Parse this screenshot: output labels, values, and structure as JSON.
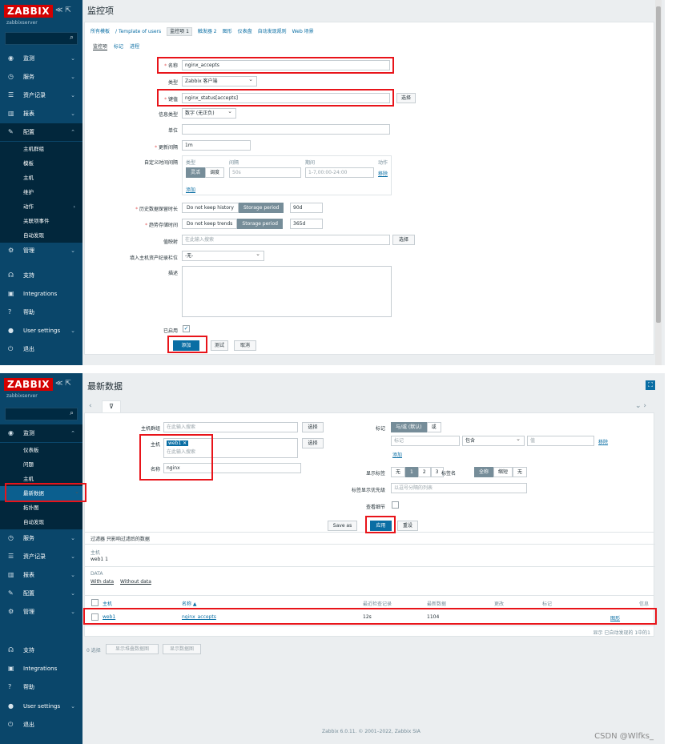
{
  "sidebar": {
    "logo": "ZABBIX",
    "collapse_icons": "≪ ⇱",
    "server": "zabbixserver",
    "search_icon": "search-icon"
  },
  "panel1": {
    "page_title": "监控项",
    "breadcrumb": [
      "所有模板",
      "Template of users",
      "监控项 1",
      "触发器 2",
      "图形",
      "仪表盘",
      "自动发现规则",
      "Web 场景"
    ],
    "tabs": [
      "监控项",
      "标记",
      "进程"
    ],
    "menu": [
      {
        "label": "监测",
        "icon": "eye-icon"
      },
      {
        "label": "服务",
        "icon": "clock-icon"
      },
      {
        "label": "资产记录",
        "icon": "list-icon"
      },
      {
        "label": "报表",
        "icon": "chart-icon"
      },
      {
        "label": "配置",
        "icon": "wrench-icon"
      }
    ],
    "submenu": [
      "主机群组",
      "模板",
      "主机",
      "维护",
      "动作",
      "关联项事件",
      "自动发现"
    ],
    "menu_bottom": [
      {
        "label": "管理",
        "icon": "gear-icon"
      },
      {
        "label": "支持",
        "icon": "headset-icon"
      },
      {
        "label": "Integrations",
        "icon": "z-icon"
      },
      {
        "label": "帮助",
        "icon": "question-icon"
      },
      {
        "label": "User settings",
        "icon": "user-icon"
      },
      {
        "label": "退出",
        "icon": "power-icon"
      }
    ],
    "form": {
      "name_label": "名称",
      "name_value": "nginx_accepts",
      "type_label": "类型",
      "type_value": "Zabbix 客户端",
      "key_label": "键值",
      "key_value": "nginx_status[accepts]",
      "key_select": "选择",
      "info_type_label": "信息类型",
      "info_type_value": "数字 (无正负)",
      "units_label": "单位",
      "interval_label": "更新间隔",
      "interval_value": "1m",
      "custom_label": "自定义时间间隔",
      "custom_headers": [
        "类型",
        "间隔",
        "期间",
        "动作"
      ],
      "custom_type_flex": "灵活",
      "custom_type_sched": "调度",
      "custom_interval": "50s",
      "custom_period": "1-7,00:00-24:00",
      "custom_remove": "移除",
      "custom_add": "添加",
      "history_label": "历史数据保留时长",
      "history_opt1": "Do not keep history",
      "history_opt2": "Storage period",
      "history_value": "90d",
      "trends_label": "趋势存储时间",
      "trends_opt1": "Do not keep trends",
      "trends_opt2": "Storage period",
      "trends_value": "365d",
      "valuemap_label": "值映射",
      "valuemap_placeholder": "在此输入搜索",
      "valuemap_select": "选择",
      "inventory_label": "填入主机资产纪录栏位",
      "inventory_value": "-无-",
      "desc_label": "描述",
      "enabled_label": "已启用",
      "add_button": "添加",
      "test_button": "测试",
      "cancel_button": "取消"
    }
  },
  "panel2": {
    "page_title": "最新数据",
    "menu_top": [
      {
        "label": "监测",
        "icon": "eye-icon"
      }
    ],
    "submenu": [
      "仪表板",
      "问题",
      "主机",
      "最新数据",
      "拓扑图",
      "自动发现"
    ],
    "menu_mid": [
      {
        "label": "服务",
        "icon": "clock-icon"
      },
      {
        "label": "资产记录",
        "icon": "list-icon"
      },
      {
        "label": "报表",
        "icon": "chart-icon"
      },
      {
        "label": "配置",
        "icon": "wrench-icon"
      },
      {
        "label": "管理",
        "icon": "gear-icon"
      }
    ],
    "menu_bottom": [
      {
        "label": "支持",
        "icon": "headset-icon"
      },
      {
        "label": "Integrations",
        "icon": "z-icon"
      },
      {
        "label": "帮助",
        "icon": "question-icon"
      },
      {
        "label": "User settings",
        "icon": "user-icon"
      },
      {
        "label": "退出",
        "icon": "power-icon"
      }
    ],
    "filter": {
      "hostgroup_label": "主机群组",
      "hostgroup_placeholder": "在此输入搜索",
      "select": "选择",
      "host_label": "主机",
      "host_chip": "web1",
      "host_placeholder": "在此输入搜索",
      "name_label": "名称",
      "name_value": "nginx",
      "tags_label": "标记",
      "tags_and_or": "与/或 (默认)",
      "tags_or": "或",
      "tag_placeholder": "标记",
      "tag_op": "包含",
      "tag_value_placeholder": "值",
      "tag_remove": "移除",
      "tag_add": "添加",
      "show_tags_label": "显示标签",
      "show_tags_opts": [
        "无",
        "1",
        "2",
        "3"
      ],
      "tag_name_label": "标签名",
      "tag_name_opts": [
        "全称",
        "缩短",
        "无"
      ],
      "tag_priority_label": "标签显示优先级",
      "tag_priority_placeholder": "以逗号分隔的列表",
      "show_details_label": "查看细节",
      "save_as": "Save as",
      "apply": "应用",
      "reset": "重设"
    },
    "subfilter": {
      "title": "过滤器 只影响过滤后的数据",
      "host_label": "主机",
      "host_value": "web1 1",
      "data_label": "DATA",
      "with_data": "With data",
      "without_data": "Without data"
    },
    "table": {
      "headers": [
        "主机",
        "名称 ▲",
        "最近检查记录",
        "最新数据",
        "更改",
        "标记",
        "信息"
      ],
      "row": {
        "host": "web1",
        "name": "nginx_accepts",
        "last_check": "12s",
        "last_value": "1104",
        "link": "图形"
      },
      "summary": "显示 已自动发现的 1中的1"
    },
    "mass": {
      "selected": "0 选择",
      "btn1": "显示堆叠数据图",
      "btn2": "显示数据图"
    },
    "footer": "Zabbix 6.0.11. © 2001–2022, Zabbix SIA",
    "watermark": "CSDN @Wlfks_"
  }
}
